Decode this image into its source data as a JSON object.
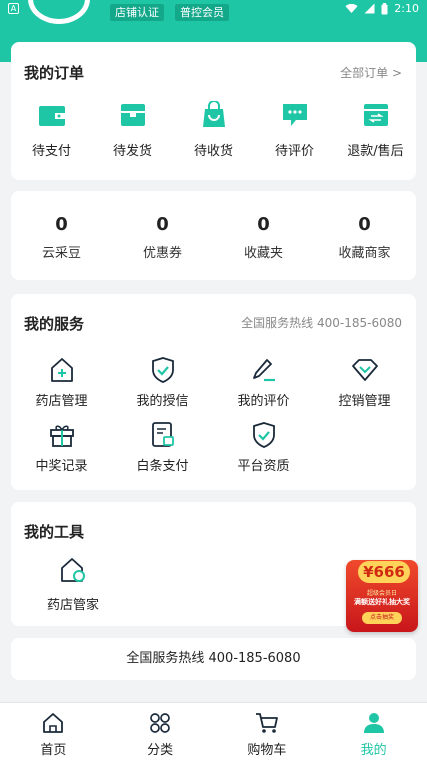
{
  "status_bar": {
    "time": "2:10",
    "notification_glyph": "A"
  },
  "header": {
    "badges": [
      "店铺认证",
      "普控会员"
    ],
    "accent_color": "#1ec6a5"
  },
  "orders": {
    "title": "我的订单",
    "all_link": "全部订单 >",
    "items": [
      {
        "label": "待支付",
        "icon": "wallet-icon"
      },
      {
        "label": "待发货",
        "icon": "box-icon"
      },
      {
        "label": "待收货",
        "icon": "shopping-bag-icon"
      },
      {
        "label": "待评价",
        "icon": "chat-bubble-icon"
      },
      {
        "label": "退款/售后",
        "icon": "refund-icon"
      }
    ]
  },
  "stats": [
    {
      "value": "0",
      "label": "云采豆"
    },
    {
      "value": "0",
      "label": "优惠券"
    },
    {
      "value": "0",
      "label": "收藏夹"
    },
    {
      "value": "0",
      "label": "收藏商家"
    }
  ],
  "services": {
    "title": "我的服务",
    "hotline": "全国服务热线 400-185-6080",
    "items": [
      {
        "label": "药店管理",
        "icon": "pharmacy-house-icon"
      },
      {
        "label": "我的授信",
        "icon": "shield-check-icon"
      },
      {
        "label": "我的评价",
        "icon": "pen-icon"
      },
      {
        "label": "控销管理",
        "icon": "diamond-icon"
      },
      {
        "label": "中奖记录",
        "icon": "gift-icon"
      },
      {
        "label": "白条支付",
        "icon": "bill-icon"
      },
      {
        "label": "平台资质",
        "icon": "certificate-shield-icon"
      }
    ]
  },
  "tools": {
    "title": "我的工具",
    "items": [
      {
        "label": "药店管家",
        "icon": "house-gear-icon"
      }
    ]
  },
  "hotline_bar": "全国服务热线 400-185-6080",
  "promo": {
    "amount": "¥666",
    "line1": "超级会员日",
    "line2": "满额送好礼抽大奖",
    "button": "点击抽奖"
  },
  "tabbar": {
    "items": [
      {
        "label": "首页",
        "icon": "home-icon",
        "active": false
      },
      {
        "label": "分类",
        "icon": "category-icon",
        "active": false
      },
      {
        "label": "购物车",
        "icon": "cart-icon",
        "active": false
      },
      {
        "label": "我的",
        "icon": "profile-icon",
        "active": true
      }
    ]
  }
}
